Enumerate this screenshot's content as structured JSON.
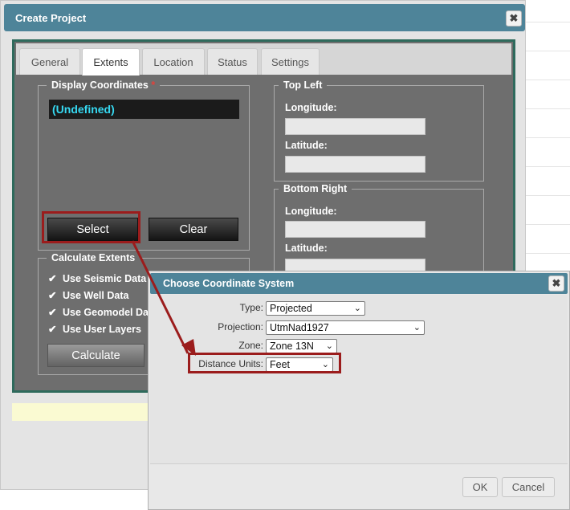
{
  "main_dialog": {
    "title": "Create Project",
    "close_icon": "✖",
    "tabs": [
      {
        "label": "General"
      },
      {
        "label": "Extents",
        "active": true
      },
      {
        "label": "Location"
      },
      {
        "label": "Status"
      },
      {
        "label": "Settings"
      }
    ],
    "display_coordinates": {
      "legend": "Display Coordinates",
      "required_mark": "*",
      "value": "(Undefined)",
      "select_label": "Select",
      "clear_label": "Clear"
    },
    "top_left": {
      "legend": "Top Left",
      "longitude_label": "Longitude:",
      "latitude_label": "Latitude:",
      "longitude": "",
      "latitude": ""
    },
    "bottom_right": {
      "legend": "Bottom Right",
      "longitude_label": "Longitude:",
      "latitude_label": "Latitude:",
      "longitude": "",
      "latitude": ""
    },
    "calculate_extents": {
      "legend": "Calculate Extents",
      "options": [
        {
          "label": "Use Seismic Data",
          "checked": true
        },
        {
          "label": "Use Well Data",
          "checked": true
        },
        {
          "label": "Use Geomodel Data",
          "checked": true
        },
        {
          "label": "Use User Layers",
          "checked": true
        }
      ],
      "check_glyph": "✔",
      "calculate_label": "Calculate"
    }
  },
  "coordinate_dialog": {
    "title": "Choose Coordinate System",
    "close_icon": "✖",
    "fields": {
      "type": {
        "label": "Type:",
        "value": "Projected"
      },
      "projection": {
        "label": "Projection:",
        "value": "UtmNad1927"
      },
      "zone": {
        "label": "Zone:",
        "value": "Zone 13N"
      },
      "distance_units": {
        "label": "Distance Units:",
        "value": "Feet"
      }
    },
    "chevron_icon": "⌄",
    "ok_label": "OK",
    "cancel_label": "Cancel"
  },
  "colors": {
    "title_bar": "#4e8499",
    "frame_border": "#2e6a5c",
    "panel": "#6e6e6e",
    "highlight": "#9b1c1c",
    "coordinate_text": "#36d9f2"
  }
}
